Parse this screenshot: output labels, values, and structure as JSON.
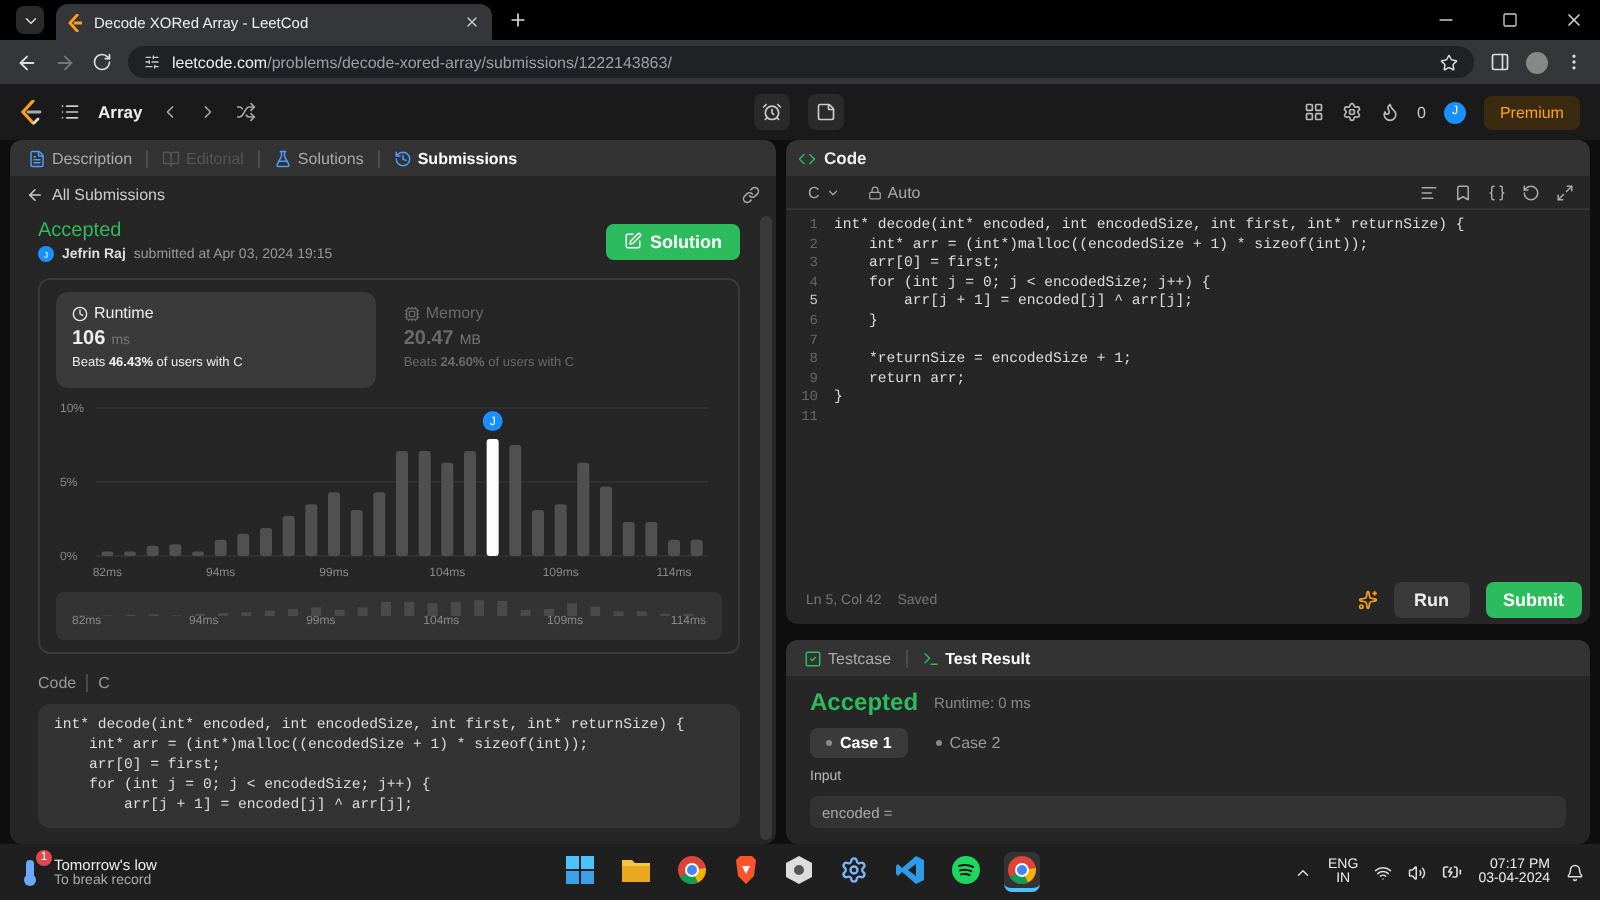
{
  "browser": {
    "tab_title": "Decode XORed Array - LeetCod",
    "url_host": "leetcode.com",
    "url_path": "/problems/decode-xored-array/submissions/1222143863/"
  },
  "nav": {
    "problem_list": "Array",
    "streak": "0",
    "avatar": "J",
    "premium": "Premium"
  },
  "left_tabs": [
    {
      "label": "Description",
      "selected": false,
      "disabled": false
    },
    {
      "label": "Editorial",
      "selected": false,
      "disabled": true
    },
    {
      "label": "Solutions",
      "selected": false,
      "disabled": false
    },
    {
      "label": "Submissions",
      "selected": true,
      "disabled": false
    }
  ],
  "back_link": "All Submissions",
  "submission": {
    "status": "Accepted",
    "avatar": "J",
    "author": "Jefrin Raj",
    "submitted": "submitted at Apr 03, 2024 19:15",
    "solution_button": "Solution"
  },
  "stats": [
    {
      "kind": "runtime",
      "title": "Runtime",
      "value": "106",
      "unit": "ms",
      "beats": "Beats **46.43%** of users with C",
      "selected": true
    },
    {
      "kind": "memory",
      "title": "Memory",
      "value": "20.47",
      "unit": "MB",
      "beats": "Beats **24.60%** of users with C",
      "selected": false
    }
  ],
  "chart_data": {
    "type": "bar",
    "categories": [
      "82ms",
      null,
      null,
      null,
      null,
      "94ms",
      null,
      null,
      null,
      null,
      "99ms",
      null,
      null,
      null,
      null,
      "104ms",
      null,
      null,
      null,
      null,
      "109ms",
      null,
      null,
      null,
      null,
      "114ms",
      null
    ],
    "values": [
      0.3,
      0.3,
      0.7,
      0.8,
      0.3,
      1.1,
      1.5,
      1.9,
      2.7,
      3.5,
      4.3,
      3.1,
      4.3,
      7.1,
      7.1,
      6.3,
      7.1,
      7.9,
      7.5,
      3.1,
      3.5,
      6.3,
      4.7,
      2.3,
      2.3,
      1.1,
      1.1
    ],
    "ylim": [
      0,
      10
    ],
    "yticks": [
      {
        "value": 0,
        "label": "0%"
      },
      {
        "value": 5,
        "label": "5%"
      },
      {
        "value": 10,
        "label": "10%"
      }
    ],
    "annotations": [
      {
        "y": 7.9,
        "text": "J"
      }
    ]
  },
  "overview_labels": [
    "82ms",
    "94ms",
    "99ms",
    "104ms",
    "109ms",
    "114ms"
  ],
  "code_section": {
    "title": "Code",
    "language": "C",
    "lines": [
      "int* decode(int* encoded, int encodedSize, int first, int* returnSize) {",
      "    int* arr = (int*)malloc((encodedSize + 1) * sizeof(int));",
      "    arr[0] = first;",
      "    for (int j = 0; j < encodedSize; j++) {",
      "        arr[j + 1] = encoded[j] ^ arr[j];"
    ]
  },
  "editor": {
    "title": "Code",
    "language": "C",
    "mode": "Auto",
    "lines": [
      {
        "number": "1",
        "code": "int* decode(int* encoded, int encodedSize, int first, int* returnSize) {"
      },
      {
        "number": "2",
        "code": "    int* arr = (int*)malloc((encodedSize + 1) * sizeof(int));"
      },
      {
        "number": "3",
        "code": "    arr[0] = first;"
      },
      {
        "number": "4",
        "code": "    for (int j = 0; j < encodedSize; j++) {"
      },
      {
        "number": "5",
        "code": "        arr[j + 1] = encoded[j] ^ arr[j];"
      },
      {
        "number": "6",
        "code": "    }"
      },
      {
        "number": "7"
      },
      {
        "number": "8",
        "code": "    *returnSize = encodedSize + 1;"
      },
      {
        "number": "9",
        "code": "    return arr;"
      },
      {
        "number": "10",
        "code": "}"
      },
      {
        "number": "11"
      }
    ],
    "cursor": "Ln 5, Col 42",
    "save_state": "Saved",
    "run": "Run",
    "submit": "Submit"
  },
  "test_tabs": [
    {
      "label": "Testcase",
      "selected": false
    },
    {
      "label": "Test Result",
      "selected": true
    }
  ],
  "result": {
    "status": "Accepted",
    "runtime": "Runtime: 0 ms",
    "cases": [
      {
        "label": "Case 1",
        "selected": true
      },
      {
        "label": "Case 2",
        "selected": false
      }
    ],
    "input_label": "Input",
    "input_value": "encoded ="
  },
  "taskbar": {
    "weather_title": "Tomorrow's low",
    "weather_text": "To break record",
    "notification_count": "1",
    "language": "ENG",
    "region": "IN",
    "time": "07:17 PM",
    "date": "03-04-2024"
  }
}
